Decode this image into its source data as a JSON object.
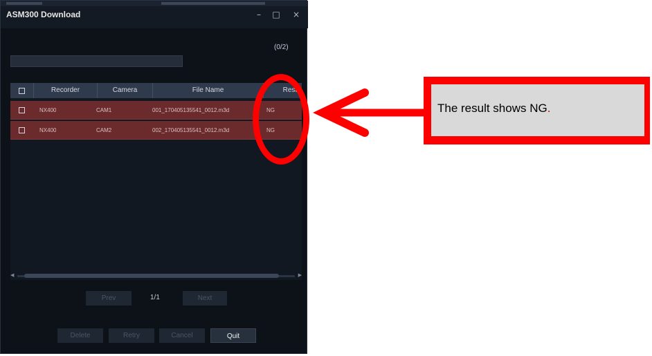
{
  "window": {
    "title": "ASM300 Download",
    "controls": {
      "minimize": "–",
      "maximize": "□",
      "close": "×"
    },
    "progress_count": "(0/2)"
  },
  "table": {
    "headers": {
      "recorder": "Recorder",
      "camera": "Camera",
      "file_name": "File Name",
      "result": "Resu"
    },
    "rows": [
      {
        "recorder": "NX400",
        "camera": "CAM1",
        "file_name": "001_170405135541_0012.m3d",
        "result": "NG"
      },
      {
        "recorder": "NX400",
        "camera": "CAM2",
        "file_name": "002_170405135541_0012.m3d",
        "result": "NG"
      }
    ],
    "row_color": "#6b2a2c"
  },
  "pagination": {
    "prev": "Prev",
    "page": "1/1",
    "next": "Next"
  },
  "actions": {
    "delete": "Delete",
    "retry": "Retry",
    "cancel": "Cancel",
    "quit": "Quit"
  },
  "annotation": {
    "callout_text": "The result shows NG",
    "callout_period": ".",
    "accent_color": "#ff0000"
  }
}
